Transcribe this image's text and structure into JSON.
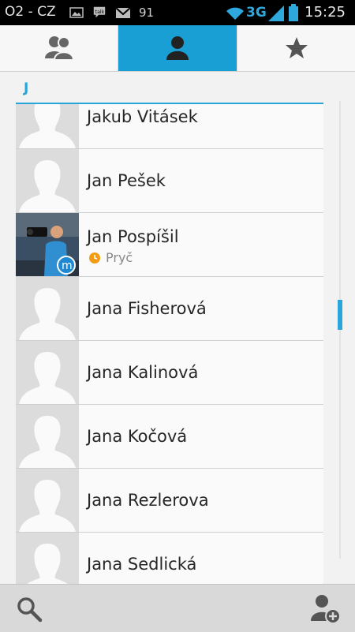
{
  "statusbar": {
    "carrier": "O2 - CZ",
    "notification_count": "91",
    "network": "3G",
    "time": "15:25"
  },
  "tabs": [
    {
      "name": "groups",
      "icon": "groups-icon",
      "selected": false
    },
    {
      "name": "contacts",
      "icon": "person-icon",
      "selected": true
    },
    {
      "name": "favorites",
      "icon": "star-icon",
      "selected": false
    }
  ],
  "section": {
    "letter": "J"
  },
  "contacts": [
    {
      "name": "Jakub Vitásek"
    },
    {
      "name": "Jan Pešek"
    },
    {
      "name": "Jan Pospíšil",
      "status": "Pryč",
      "has_photo": true
    },
    {
      "name": "Jana Fisherová"
    },
    {
      "name": "Jana Kalinová"
    },
    {
      "name": "Jana Kočová"
    },
    {
      "name": "Jana Rezlerova"
    },
    {
      "name": "Jana Sedlická"
    }
  ],
  "colors": {
    "accent": "#1a9fd4",
    "status_away": "#f39c12"
  },
  "bottombar": {
    "search_icon": "search-icon",
    "add_contact_icon": "add-contact-icon"
  }
}
